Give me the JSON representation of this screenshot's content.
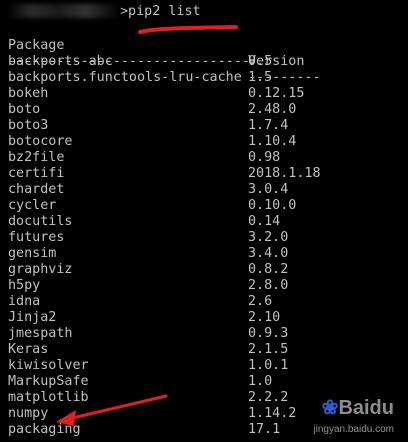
{
  "prompt": {
    "command": ">pip2 list"
  },
  "table": {
    "header": {
      "package": "Package",
      "version": "Version"
    },
    "separator": {
      "package": "------------------------------",
      "version": "---------"
    },
    "rows": [
      {
        "package": "backports-abc",
        "version": "0.5"
      },
      {
        "package": "backports.functools-lru-cache",
        "version": "1.5"
      },
      {
        "package": "bokeh",
        "version": "0.12.15"
      },
      {
        "package": "boto",
        "version": "2.48.0"
      },
      {
        "package": "boto3",
        "version": "1.7.4"
      },
      {
        "package": "botocore",
        "version": "1.10.4"
      },
      {
        "package": "bz2file",
        "version": "0.98"
      },
      {
        "package": "certifi",
        "version": "2018.1.18"
      },
      {
        "package": "chardet",
        "version": "3.0.4"
      },
      {
        "package": "cycler",
        "version": "0.10.0"
      },
      {
        "package": "docutils",
        "version": "0.14"
      },
      {
        "package": "futures",
        "version": "3.2.0"
      },
      {
        "package": "gensim",
        "version": "3.4.0"
      },
      {
        "package": "graphviz",
        "version": "0.8.2"
      },
      {
        "package": "h5py",
        "version": "2.8.0"
      },
      {
        "package": "idna",
        "version": "2.6"
      },
      {
        "package": "Jinja2",
        "version": "2.10"
      },
      {
        "package": "jmespath",
        "version": "0.9.3"
      },
      {
        "package": "Keras",
        "version": "2.1.5"
      },
      {
        "package": "kiwisolver",
        "version": "1.0.1"
      },
      {
        "package": "MarkupSafe",
        "version": "1.0"
      },
      {
        "package": "matplotlib",
        "version": "2.2.2"
      },
      {
        "package": "numpy",
        "version": "1.14.2"
      },
      {
        "package": "packaging",
        "version": "17.1"
      }
    ]
  },
  "watermark": {
    "logo": "Baidu",
    "url": "jingyan.baidu.com"
  },
  "colors": {
    "background": "#000000",
    "text": "#c0c0c0",
    "annotation": "#e02020"
  }
}
